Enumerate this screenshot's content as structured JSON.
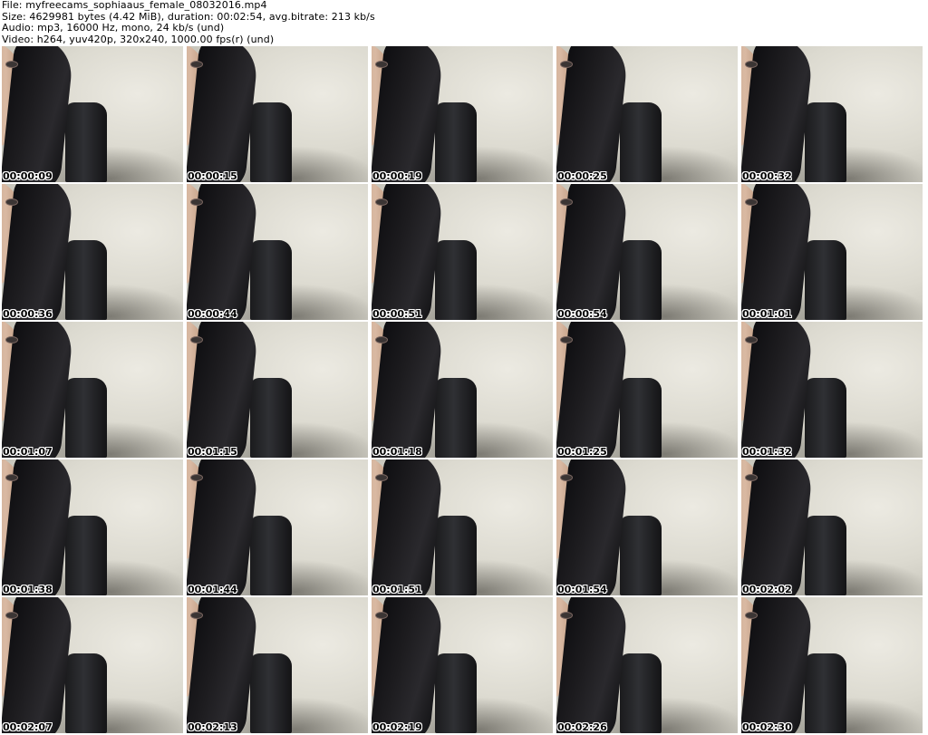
{
  "header": {
    "file": "File: myfreecams_sophiaaus_female_08032016.mp4",
    "size": "Size: 4629981 bytes (4.42 MiB), duration: 00:02:54, avg.bitrate: 213 kb/s",
    "audio": "Audio: mp3, 16000 Hz, mono, 24 kb/s (und)",
    "video": "Video: h264, yuv420p, 320x240, 1000.00 fps(r) (und)"
  },
  "thumbnails": [
    "00:00:09",
    "00:00:15",
    "00:00:19",
    "00:00:25",
    "00:00:32",
    "00:00:36",
    "00:00:44",
    "00:00:51",
    "00:00:54",
    "00:01:01",
    "00:01:07",
    "00:01:15",
    "00:01:18",
    "00:01:25",
    "00:01:32",
    "00:01:38",
    "00:01:44",
    "00:01:51",
    "00:01:54",
    "00:02:02",
    "00:02:07",
    "00:02:13",
    "00:02:19",
    "00:02:26",
    "00:02:30"
  ]
}
